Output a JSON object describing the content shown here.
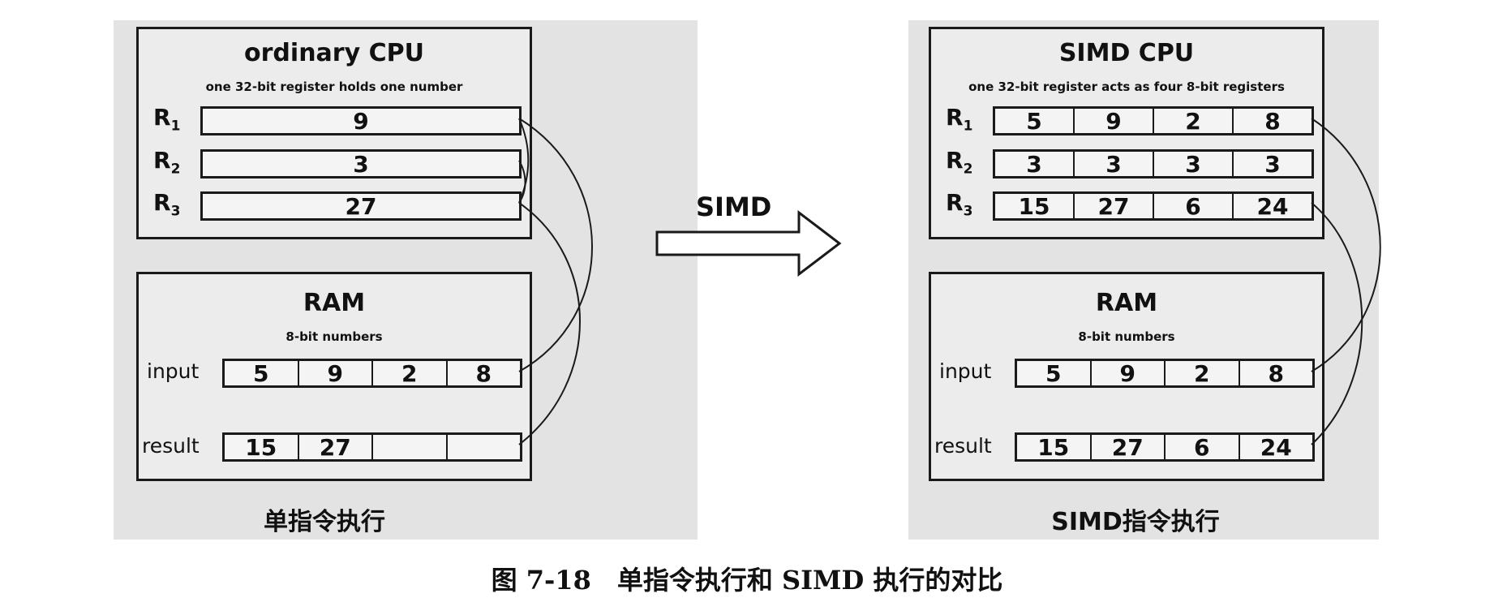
{
  "left_cpu": {
    "title": "ordinary CPU",
    "subtitle": "one 32-bit register holds one number",
    "registers": [
      {
        "label": "R",
        "index": "1",
        "values": [
          "9"
        ]
      },
      {
        "label": "R",
        "index": "2",
        "values": [
          "3"
        ]
      },
      {
        "label": "R",
        "index": "3",
        "values": [
          "27"
        ]
      }
    ]
  },
  "left_ram": {
    "title": "RAM",
    "subtitle": "8-bit numbers",
    "rows": [
      {
        "label": "input",
        "values": [
          "5",
          "9",
          "2",
          "8"
        ]
      },
      {
        "label": "result",
        "values": [
          "15",
          "27",
          "",
          ""
        ]
      }
    ]
  },
  "left_caption": "单指令执行",
  "arrow_label": "SIMD",
  "right_cpu": {
    "title": "SIMD CPU",
    "subtitle": "one 32-bit register acts as four 8-bit registers",
    "registers": [
      {
        "label": "R",
        "index": "1",
        "values": [
          "5",
          "9",
          "2",
          "8"
        ]
      },
      {
        "label": "R",
        "index": "2",
        "values": [
          "3",
          "3",
          "3",
          "3"
        ]
      },
      {
        "label": "R",
        "index": "3",
        "values": [
          "15",
          "27",
          "6",
          "24"
        ]
      }
    ]
  },
  "right_ram": {
    "title": "RAM",
    "subtitle": "8-bit numbers",
    "rows": [
      {
        "label": "input",
        "values": [
          "5",
          "9",
          "2",
          "8"
        ]
      },
      {
        "label": "result",
        "values": [
          "15",
          "27",
          "6",
          "24"
        ]
      }
    ]
  },
  "right_caption": "SIMD指令执行",
  "figure_caption": "图 7-18　单指令执行和 SIMD 执行的对比"
}
